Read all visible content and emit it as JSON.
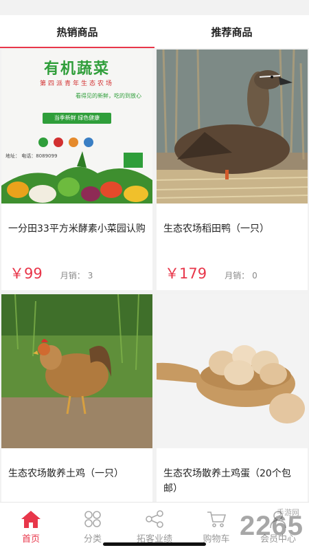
{
  "tabs": [
    {
      "label": "热销商品",
      "active": true
    },
    {
      "label": "推荐商品",
      "active": false
    }
  ],
  "poster": {
    "title": "有机蔬菜",
    "subtitle": "第四派青年生态农场",
    "slogan": "看得见的新鲜，吃的到放心",
    "banner": "当季新鲜  绿色健康",
    "contact": "地址：  电话：8089099"
  },
  "products": [
    {
      "title": "一分田33平方米酵素小菜园认购",
      "price": "￥99",
      "sold_label": "月销：",
      "sold_count": "3",
      "image": "vegetable-poster"
    },
    {
      "title": "生态农场稻田鸭（一只）",
      "price": "￥179",
      "sold_label": "月销：",
      "sold_count": "0",
      "image": "duck-photo"
    },
    {
      "title": "生态农场散养土鸡（一只）",
      "image": "chicken-photo"
    },
    {
      "title": "生态农场散养土鸡蛋（20个包邮）",
      "image": "eggs-photo"
    }
  ],
  "nav": [
    {
      "label": "首页",
      "icon": "home-icon",
      "active": true
    },
    {
      "label": "分类",
      "icon": "category-icon",
      "active": false
    },
    {
      "label": "拓客业绩",
      "icon": "share-icon",
      "active": false
    },
    {
      "label": "购物车",
      "icon": "cart-icon",
      "active": false
    },
    {
      "label": "会员中心",
      "icon": "user-icon",
      "active": false
    }
  ],
  "watermark": {
    "text": "2265",
    "small": "手游网"
  },
  "colors": {
    "accent": "#e8364a",
    "nav_inactive": "#999999"
  }
}
